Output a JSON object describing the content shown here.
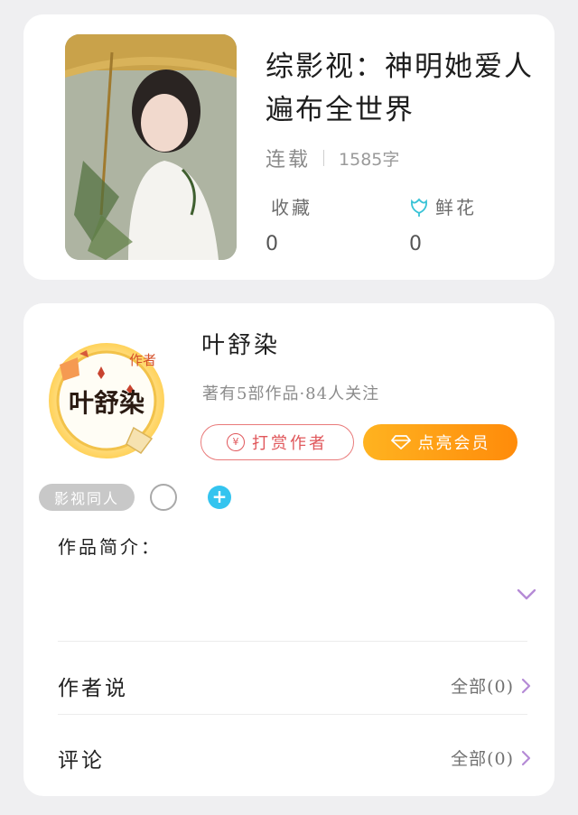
{
  "book": {
    "title": "综影视：神明她爱人遍布全世界",
    "status": "连载",
    "word_count": "1585字",
    "favorites_label": "收藏",
    "favorites_value": "0",
    "flowers_label": "鲜花",
    "flowers_value": "0"
  },
  "author": {
    "name": "叶舒染",
    "stats": "著有5部作品·84人关注",
    "badge_text": "叶舒染",
    "badge_tag": "作者",
    "reward_label": "打赏作者",
    "reward_icon_text": "¥",
    "vip_label": "点亮会员"
  },
  "tags": [
    {
      "label": "影视同人"
    }
  ],
  "add_tag_label": "+",
  "intro": {
    "label": "作品简介："
  },
  "rows": {
    "author_says": {
      "label": "作者说",
      "link": "全部(0)"
    },
    "comments": {
      "label": "评论",
      "link": "全部(0)"
    }
  },
  "colors": {
    "background": "#efeff1",
    "reward_red": "#e0575b",
    "vip_orange": "#ff9a12",
    "plus_blue": "#34c4ef",
    "chevron_purple": "#b58bd6",
    "flower_teal": "#39c3d6"
  }
}
